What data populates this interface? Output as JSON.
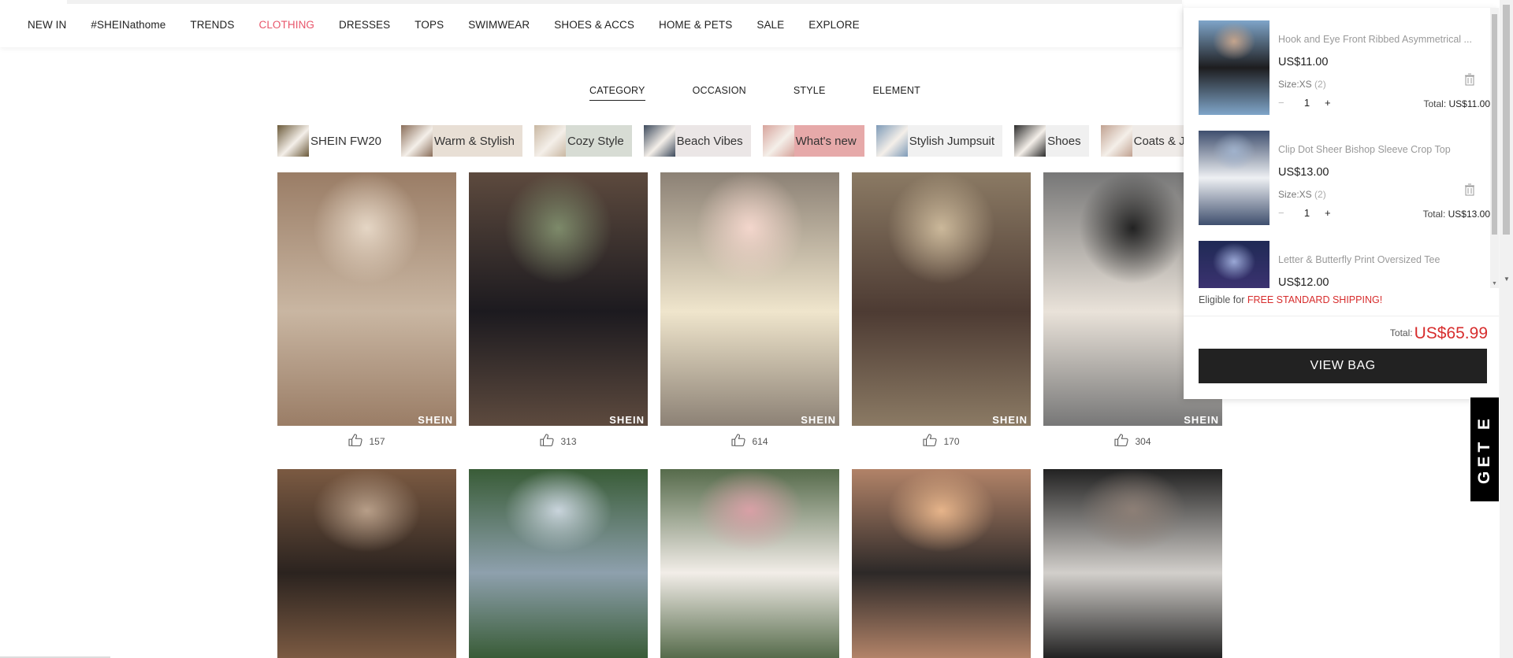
{
  "nav": {
    "items": [
      "NEW IN",
      "#SHEINathome",
      "TRENDS",
      "CLOTHING",
      "DRESSES",
      "TOPS",
      "SWIMWEAR",
      "SHOES & ACCS",
      "HOME & PETS",
      "SALE",
      "EXPLORE"
    ],
    "active": "CLOTHING"
  },
  "filter_tabs": [
    "CATEGORY",
    "OCCASION",
    "STYLE",
    "ELEMENT"
  ],
  "filter_active": "CATEGORY",
  "chips": [
    {
      "label": "SHEIN FW20",
      "bg": "#ffffff",
      "thumb": "#6b5a3a"
    },
    {
      "label": "Warm & Stylish",
      "bg": "#e8dfd5",
      "thumb": "#8a6e5a"
    },
    {
      "label": "Cozy Style",
      "bg": "#d7dcd4",
      "thumb": "#c9b8a3"
    },
    {
      "label": "Beach Vibes",
      "bg": "#ebe6e6",
      "thumb": "#3d4a5c"
    },
    {
      "label": "What's new",
      "bg": "#e6a9a9",
      "thumb": "#d7a49c"
    },
    {
      "label": "Stylish Jumpsuit",
      "bg": "#f1f1f1",
      "thumb": "#7e9bb8"
    },
    {
      "label": "Shoes",
      "bg": "#f0f0f0",
      "thumb": "#2b2b2b"
    },
    {
      "label": "Coats & Jackets",
      "bg": "#efebe8",
      "thumb": "#c1a291"
    }
  ],
  "grid": {
    "watermark": "SHEIN",
    "row1": [
      {
        "likes": "157",
        "colors": [
          "#c9b6a2",
          "#9a7d66",
          "#e5d6c5"
        ]
      },
      {
        "likes": "313",
        "colors": [
          "#1c1a1f",
          "#5d4a3e",
          "#7d8a6a"
        ]
      },
      {
        "likes": "614",
        "colors": [
          "#efe5cc",
          "#8c8175",
          "#f3d6cc"
        ]
      },
      {
        "likes": "170",
        "colors": [
          "#4d3b33",
          "#8b7a64",
          "#cbb89a"
        ]
      },
      {
        "likes": "304",
        "colors": [
          "#e9e2d9",
          "#777",
          "#222"
        ]
      }
    ],
    "row2": [
      {
        "colors": [
          "#2b231f",
          "#7b5a42",
          "#b79e88"
        ]
      },
      {
        "colors": [
          "#8ea0ad",
          "#395c37",
          "#c9d4dc"
        ]
      },
      {
        "colors": [
          "#f2ede8",
          "#566b4b",
          "#d8a0a6"
        ]
      },
      {
        "colors": [
          "#2d2928",
          "#b28368",
          "#e6b48a"
        ]
      },
      {
        "colors": [
          "#d2cfcb",
          "#222",
          "#8d7f76"
        ]
      }
    ]
  },
  "cart": {
    "items": [
      {
        "name": "Hook and Eye Front Ribbed Asymmetrical ...",
        "price": "US$11.00",
        "size_label": "Size:XS",
        "size_count": "(2)",
        "qty": "1",
        "total_label": "Total:",
        "total": "US$11.00",
        "colors": [
          "#1d1d1f",
          "#7fa5c9",
          "#c4a48d"
        ]
      },
      {
        "name": "Clip Dot Sheer Bishop Sleeve Crop Top",
        "price": "US$13.00",
        "size_label": "Size:XS",
        "size_count": "(2)",
        "qty": "1",
        "total_label": "Total:",
        "total": "US$13.00",
        "colors": [
          "#eef0f3",
          "#3f4f6e",
          "#a0b2cc"
        ]
      },
      {
        "name": "Letter & Butterfly Print Oversized Tee",
        "price": "US$12.00",
        "colors": [
          "#3b3270",
          "#1f2a55",
          "#9aa8d6"
        ]
      }
    ],
    "free_shipping_prefix": "Eligible for ",
    "free_shipping_highlight": "FREE STANDARD SHIPPING",
    "free_shipping_suffix": "!",
    "total_label": "Total:",
    "total": "US$65.99",
    "view_bag": "VIEW BAG"
  },
  "side_tab": "GET E",
  "colors": {
    "accent": "#e8566b",
    "price_red": "#d72d2d",
    "button_dark": "#222222"
  }
}
